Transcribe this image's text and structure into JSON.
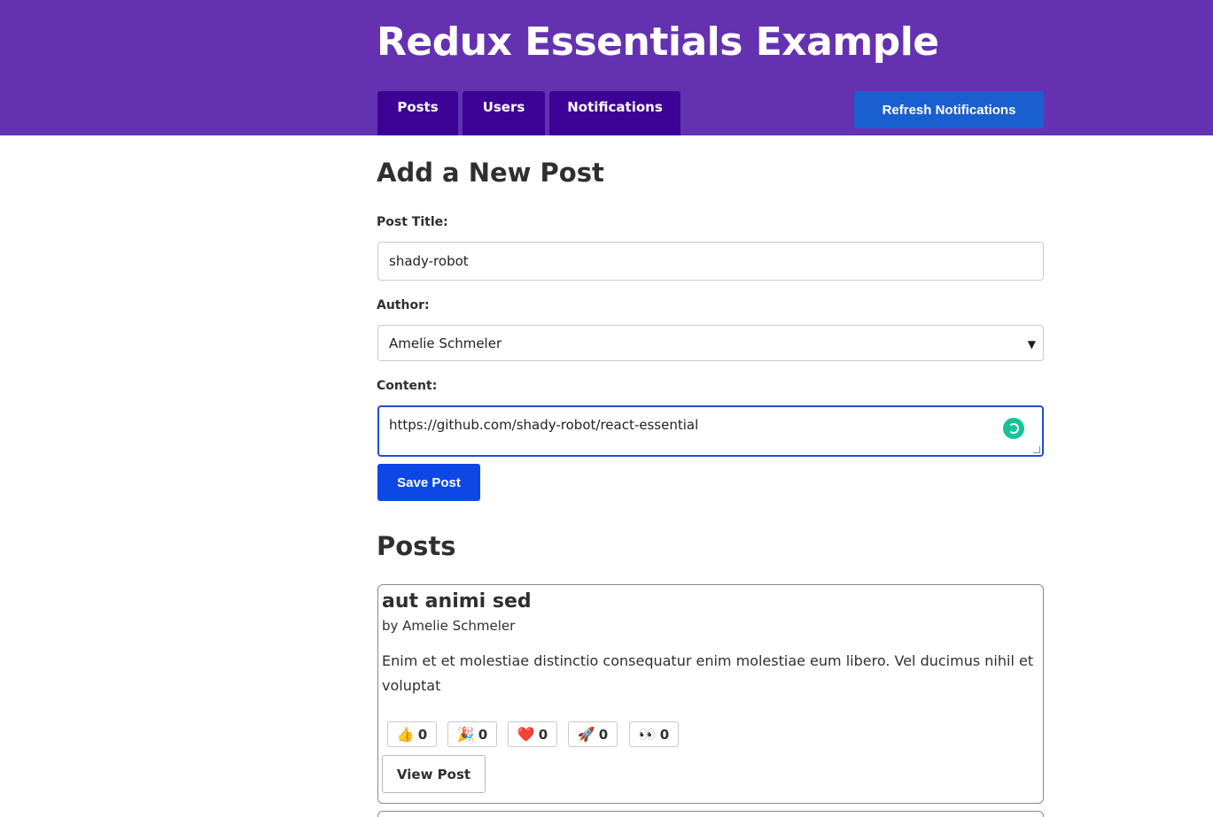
{
  "header": {
    "title": "Redux Essentials Example",
    "nav": [
      {
        "label": "Posts"
      },
      {
        "label": "Users"
      },
      {
        "label": "Notifications"
      }
    ],
    "refresh_label": "Refresh Notifications",
    "background_color": "#6432b0",
    "nav_color": "#3d0396",
    "refresh_color": "#1a5fd0"
  },
  "add_post": {
    "heading": "Add a New Post",
    "title_label": "Post Title:",
    "title_value": "shady-robot",
    "author_label": "Author:",
    "author_value": "Amelie Schmeler",
    "content_label": "Content:",
    "content_value": "https://github.com/shady-robot/react-essential",
    "save_label": "Save Post",
    "save_color": "#0d47e6"
  },
  "posts": {
    "heading": "Posts",
    "items": [
      {
        "title": "aut animi sed",
        "author": "by Amelie Schmeler",
        "excerpt": "Enim et et molestiae distinctio consequatur enim molestiae eum libero. Vel ducimus nihil et voluptat",
        "reactions": [
          {
            "icon": "thumbs-up-icon",
            "emoji": "👍",
            "count": "0"
          },
          {
            "icon": "party-popper-icon",
            "emoji": "🎉",
            "count": "0"
          },
          {
            "icon": "heart-icon",
            "emoji": "❤️",
            "count": "0"
          },
          {
            "icon": "rocket-icon",
            "emoji": "🚀",
            "count": "0"
          },
          {
            "icon": "eyes-icon",
            "emoji": "👀",
            "count": "0"
          }
        ],
        "view_label": "View Post"
      }
    ]
  }
}
